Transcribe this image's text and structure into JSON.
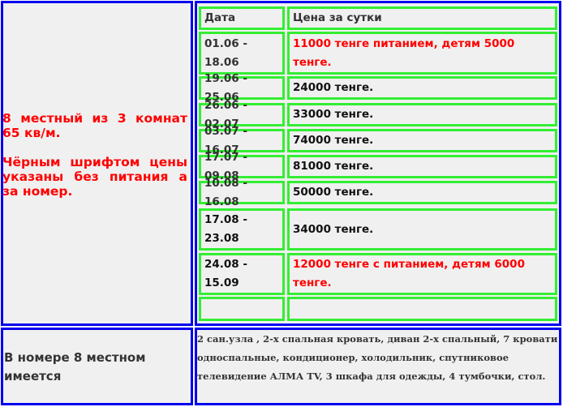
{
  "room": {
    "line1": "8 местный из 3 комнат 65 кв/м.",
    "line2": "Чёрным шрифтом цены указаны без питания а за номер."
  },
  "table": {
    "headers": [
      "Дата",
      "Цена за сутки"
    ],
    "rows": [
      {
        "date": "01.06 - 18.06",
        "price": "11000 тенге питанием, детям 5000 тенге."
      },
      {
        "date": "19.06 - 25.06",
        "price": "24000 тенге."
      },
      {
        "date": "26.06 - 02.07",
        "price": "33000 тенге."
      },
      {
        "date": "03.07 - 16.07",
        "price": "74000 тенге."
      },
      {
        "date": "17.07 - 09.08",
        "price": "81000 тенге."
      },
      {
        "date": "10.08 - 16.08",
        "price": "50000 тенге."
      },
      {
        "date": "17.08 - 23.08",
        "price": "34000 тенге."
      },
      {
        "date": "24.08 - 15.09",
        "price": "12000 тенге с питанием, детям 6000 тенге."
      }
    ]
  },
  "amenities": {
    "title": "В номере 8 местном имеется",
    "text": "2 сан.узла , 2-х спальная кровать, диван 2-х спальный, 7 кровати односпальные, кондиционер, холодильник, спутниковое телевидение АЛМА TV, 3 шкафа для одежды, 4 тумбочки, стол."
  },
  "colors": {
    "outer_border": "#0000ee",
    "inner_border": "#33ee33",
    "highlight_text": "#ff0000",
    "cell_background": "#f0f0f0"
  }
}
